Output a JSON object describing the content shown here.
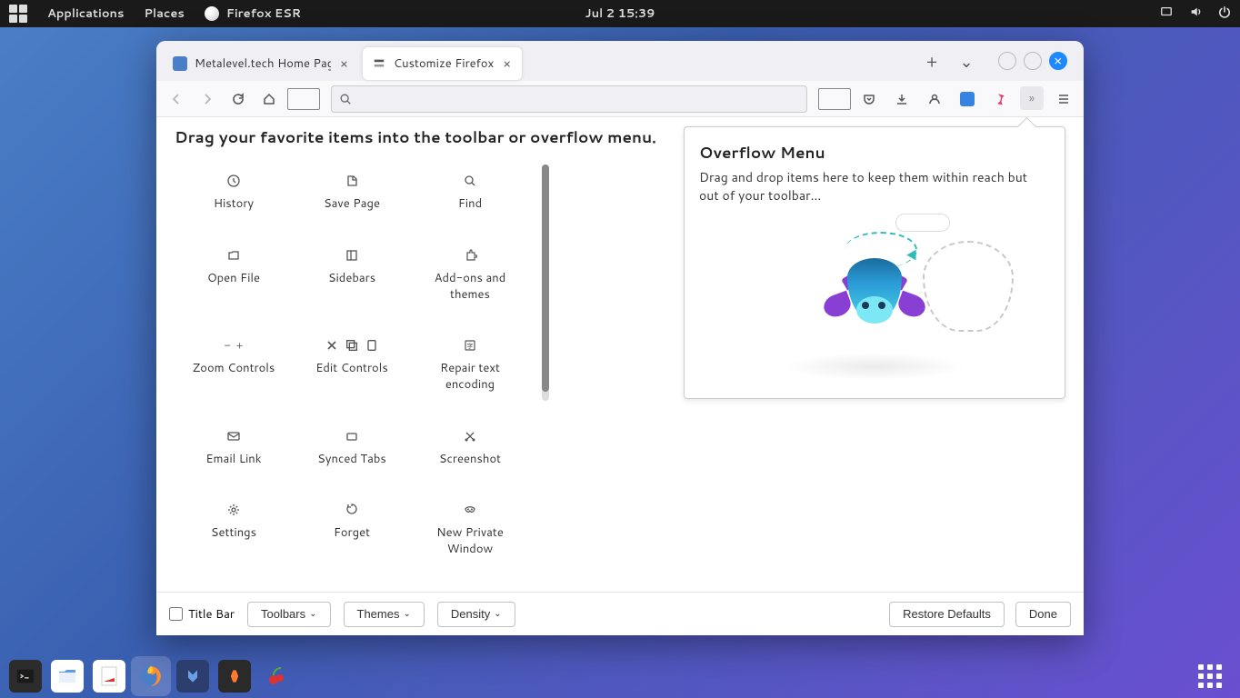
{
  "topbar": {
    "applications": "Applications",
    "places": "Places",
    "appname": "Firefox ESR",
    "datetime": "Jul 2  15:39"
  },
  "tabs": [
    {
      "title": "Metalevel.tech Home Pag",
      "active": false
    },
    {
      "title": "Customize Firefox",
      "active": true
    }
  ],
  "customize": {
    "title": "Drag your favorite items into the toolbar or overflow menu.",
    "items": [
      "History",
      "Save Page",
      "Find",
      "Open File",
      "Sidebars",
      "Add-ons and themes",
      "Zoom Controls",
      "Edit Controls",
      "Repair text encoding",
      "Email Link",
      "Synced Tabs",
      "Screenshot",
      "Settings",
      "Forget",
      "New Private Window"
    ],
    "overflow_title": "Overflow Menu",
    "overflow_desc": "Drag and drop items here to keep them within reach but out of your toolbar…"
  },
  "footer": {
    "titlebar": "Title Bar",
    "toolbars": "Toolbars",
    "themes": "Themes",
    "density": "Density",
    "restore": "Restore Defaults",
    "done": "Done"
  }
}
